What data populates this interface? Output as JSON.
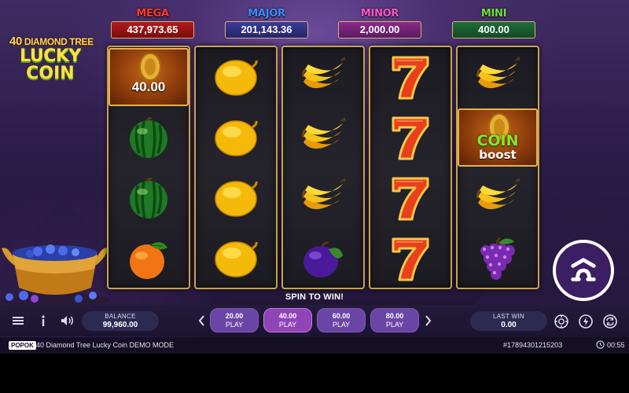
{
  "jackpots": [
    {
      "name": "MEGA",
      "value": "437,973.65"
    },
    {
      "name": "MAJOR",
      "value": "201,143.36"
    },
    {
      "name": "MINOR",
      "value": "2,000.00"
    },
    {
      "name": "MINI",
      "value": "400.00"
    }
  ],
  "logo": {
    "top_prefix": "40",
    "top_rest": "DIAMOND TREE",
    "line1": "LUCKY",
    "line2": "COIN"
  },
  "reels": [
    [
      "coin",
      "watermelon",
      "watermelon",
      "orange"
    ],
    [
      "lemon",
      "lemon",
      "lemon",
      "lemon"
    ],
    [
      "banana",
      "banana",
      "banana",
      "plum"
    ],
    [
      "seven",
      "seven",
      "seven",
      "seven"
    ],
    [
      "banana",
      "coin-boost",
      "banana",
      "grapes"
    ]
  ],
  "coin_tile": {
    "value": "40.00"
  },
  "boost_tile": {
    "line1": "COIN",
    "line2": "boost"
  },
  "spin_message": "SPIN TO WIN!",
  "balance": {
    "label": "BALANCE",
    "value": "99,960.00"
  },
  "bets": [
    {
      "amount": "20.00",
      "label": "PLAY"
    },
    {
      "amount": "40.00",
      "label": "PLAY",
      "selected": true
    },
    {
      "amount": "60.00",
      "label": "PLAY"
    },
    {
      "amount": "80.00",
      "label": "PLAY"
    }
  ],
  "last_win": {
    "label": "LAST WIN",
    "value": "0.00"
  },
  "info": {
    "brand": "POPOK",
    "game_name": "40 Diamond Tree Lucky Coin DEMO MODE",
    "round_id": "#17894301215203",
    "time": "00:55"
  },
  "colors": {
    "accent": "#8f44b8",
    "reel_border": "#c9a34a",
    "spin_button": "#3c1f63"
  },
  "icons": [
    "menu-icon",
    "info-icon",
    "sound-icon",
    "chevron-left-icon",
    "chevron-right-icon",
    "autoplay-icon",
    "turbo-icon",
    "refresh-icon",
    "clock-icon"
  ]
}
